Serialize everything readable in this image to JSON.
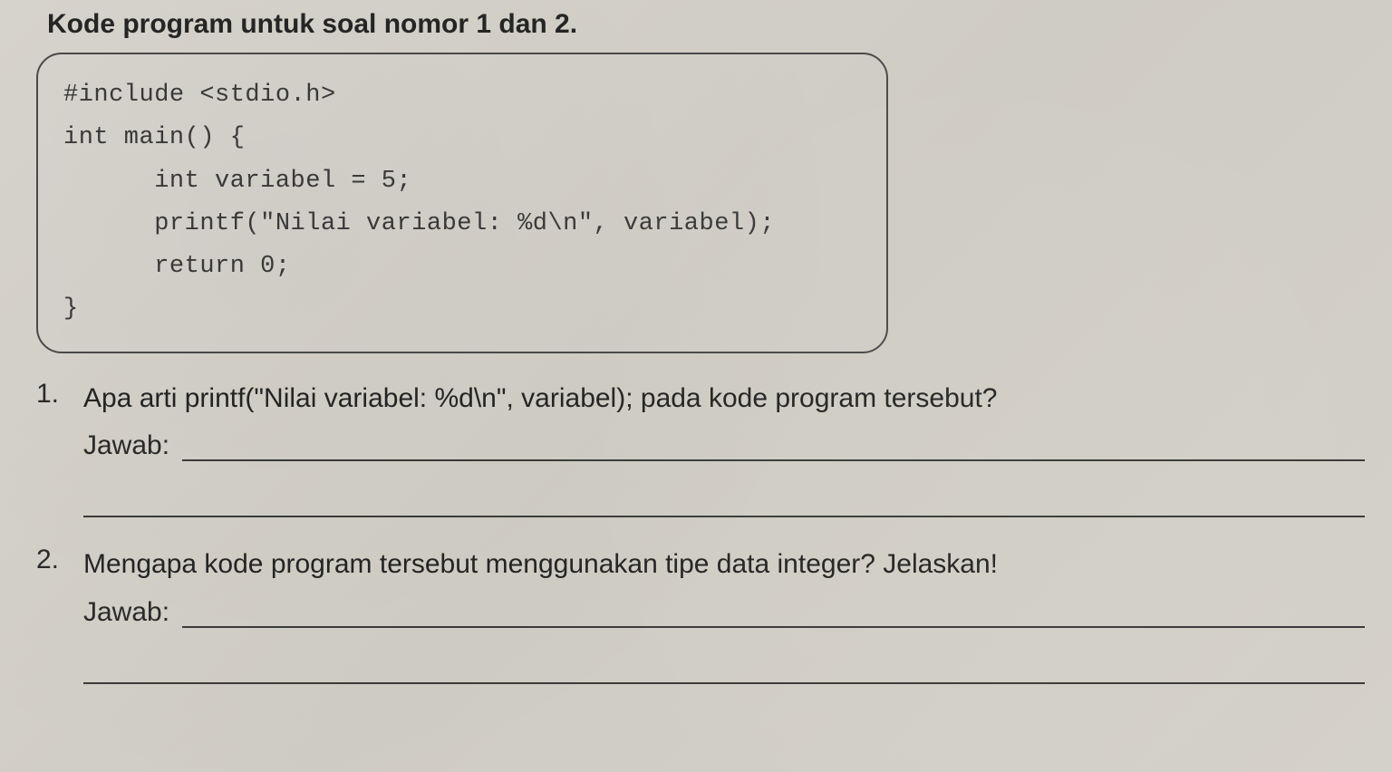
{
  "heading": "Kode program untuk soal nomor 1 dan 2.",
  "code": {
    "line1": "#include <stdio.h>",
    "line2": "int main() {",
    "line3": "      int variabel = 5;",
    "line4": "      printf(\"Nilai variabel: %d\\n\", variabel);",
    "line5": "      return 0;",
    "line6": "}"
  },
  "questions": [
    {
      "number": "1.",
      "text": "Apa arti printf(\"Nilai variabel: %d\\n\", variabel); pada kode program tersebut?",
      "answer_label": "Jawab:"
    },
    {
      "number": "2.",
      "text": "Mengapa kode program tersebut menggunakan tipe data integer? Jelaskan!",
      "answer_label": "Jawab:"
    }
  ]
}
